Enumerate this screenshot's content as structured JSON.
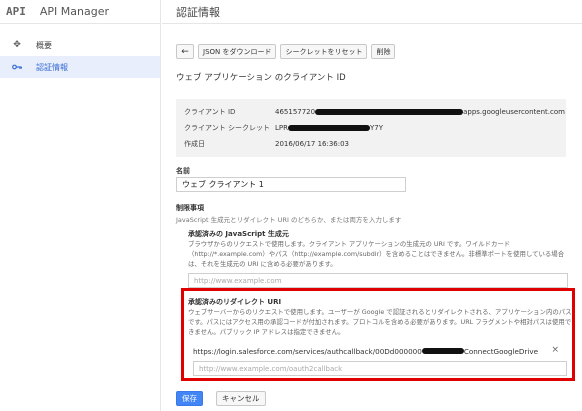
{
  "app": {
    "logo": "API",
    "title": "API Manager"
  },
  "sidebar": {
    "items": [
      {
        "label": "概要",
        "icon": "overview-icon"
      },
      {
        "label": "認証情報",
        "icon": "key-icon"
      }
    ]
  },
  "header": {
    "title": "認証情報"
  },
  "toolbar": {
    "back_label": "←",
    "download_label": "JSON をダウンロード",
    "reset_label": "シークレットをリセット",
    "delete_label": "削除"
  },
  "page": {
    "subtitle": "ウェブ アプリケーション のクライアント ID"
  },
  "credentials": {
    "client_id_label": "クライアント ID",
    "client_id_prefix": "465157720",
    "client_id_suffix": "apps.googleusercontent.com",
    "client_secret_label": "クライアント シークレット",
    "client_secret_prefix": "LPR",
    "client_secret_suffix": "Y7Y",
    "created_label": "作成日",
    "created_value": "2016/06/17 16:36:03"
  },
  "form": {
    "name_label": "名前",
    "name_value": "ウェブ クライアント 1",
    "restrictions_label": "制限事項",
    "restrictions_hint": "JavaScript 生成元とリダイレクト URI のどちらか、または両方を入力します",
    "js_origins_title": "承認済みの JavaScript 生成元",
    "js_origins_desc": "ブラウザからのリクエストで使用します。クライアント アプリケーションの生成元の URI です。ワイルドカード（http://*.example.com）やパス（http://example.com/subdir）を含めることはできません。非標準ポートを使用している場合は、それを生成元の URI に含める必要があります。",
    "js_origins_placeholder": "http://www.example.com",
    "redirect_title": "承認済みのリダイレクト URI",
    "redirect_desc": "ウェブサーバーからのリクエストで使用します。ユーザーが Google で認証されるとリダイレクトされる、アプリケーション内のパスです。パスにはアクセス用の承認コードが付加されます。プロトコルを含める必要があります。URL フラグメントや相対パスは使用できません。パブリック IP アドレスは指定できません。",
    "redirect_uri_prefix": "https://login.salesforce.com/services/authcallback/00Dd000000",
    "redirect_uri_suffix": "ConnectGoogleDrive",
    "redirect_close": "×",
    "redirect_placeholder": "http://www.example.com/oauth2callback",
    "save_label": "保存",
    "cancel_label": "キャンセル"
  },
  "colors": {
    "accent": "#4285f4",
    "highlight_border": "#e00000",
    "active_bg": "#e8eefb"
  }
}
